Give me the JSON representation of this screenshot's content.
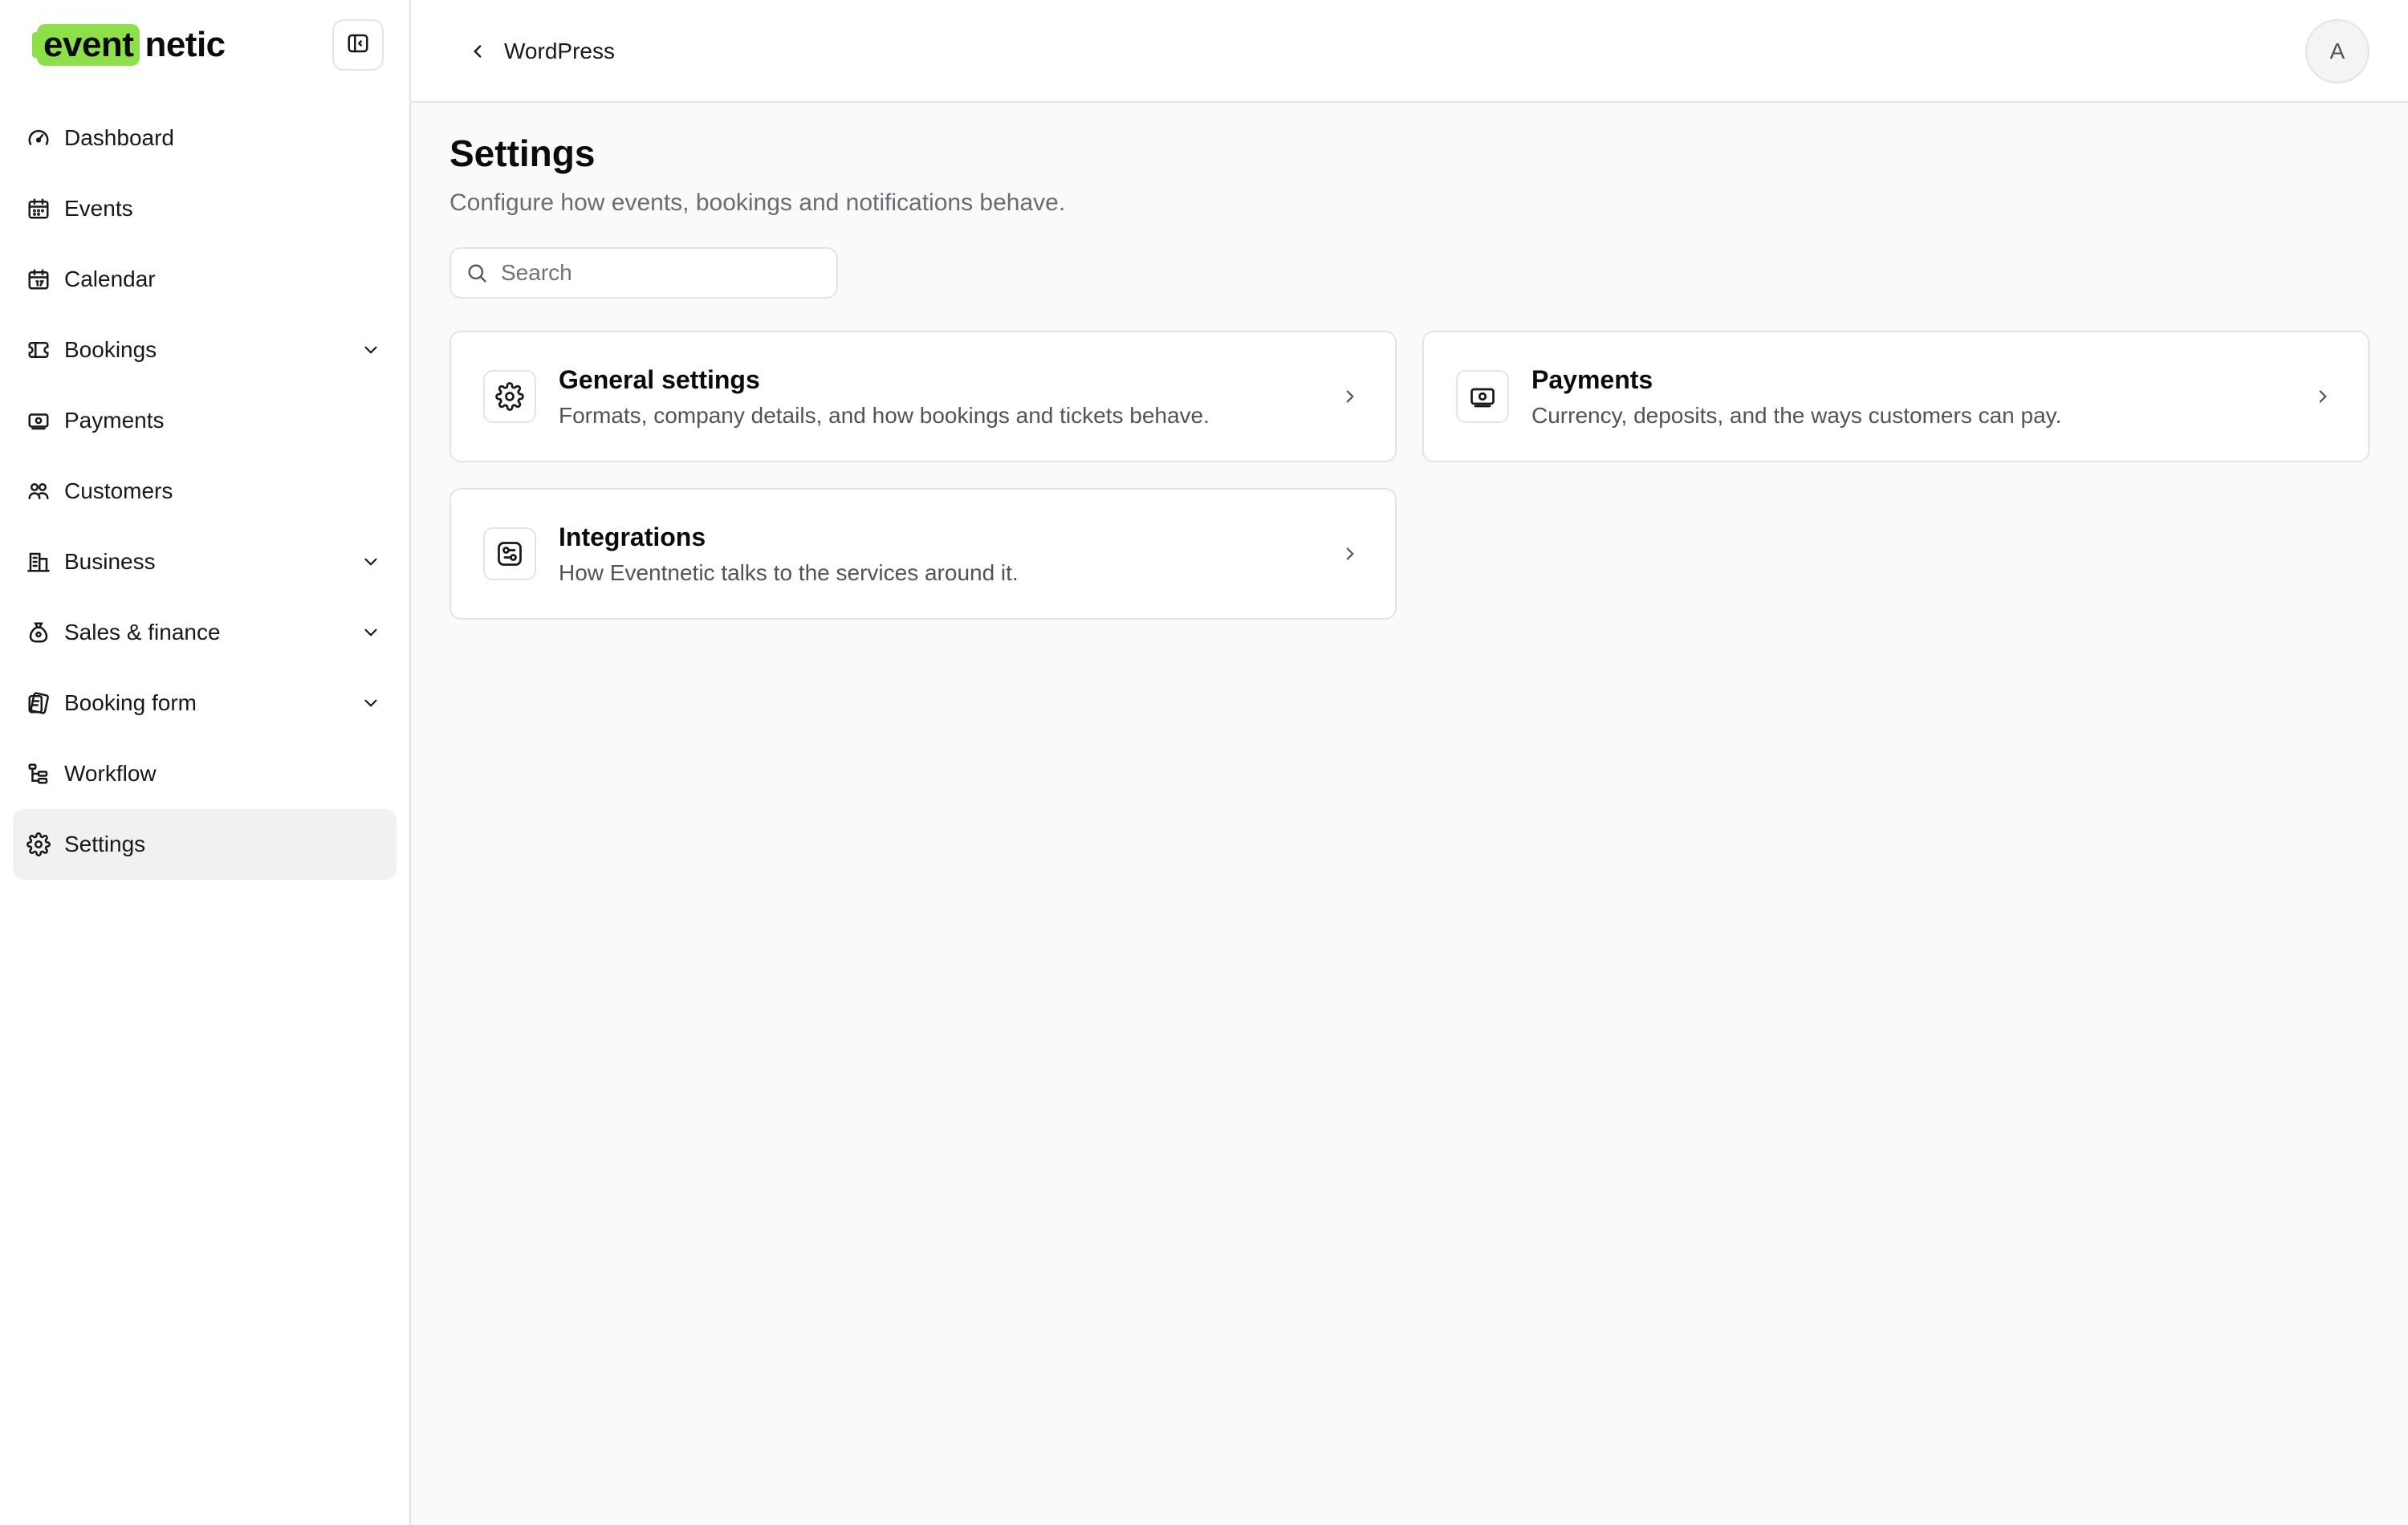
{
  "brand": {
    "part1": "event",
    "part2": "netic",
    "accent": "#8ee04a"
  },
  "sidebar": {
    "items": [
      {
        "label": "Dashboard",
        "icon": "gauge-icon",
        "expandable": false
      },
      {
        "label": "Events",
        "icon": "calendar-grid-icon",
        "expandable": false
      },
      {
        "label": "Calendar",
        "icon": "calendar-icon",
        "expandable": false
      },
      {
        "label": "Bookings",
        "icon": "ticket-icon",
        "expandable": true
      },
      {
        "label": "Payments",
        "icon": "banknote-icon",
        "expandable": false
      },
      {
        "label": "Customers",
        "icon": "users-icon",
        "expandable": false
      },
      {
        "label": "Business",
        "icon": "building-icon",
        "expandable": true
      },
      {
        "label": "Sales & finance",
        "icon": "money-bag-icon",
        "expandable": true
      },
      {
        "label": "Booking form",
        "icon": "form-icon",
        "expandable": true
      },
      {
        "label": "Workflow",
        "icon": "workflow-icon",
        "expandable": false
      },
      {
        "label": "Settings",
        "icon": "gear-icon",
        "expandable": false,
        "active": true
      }
    ]
  },
  "topbar": {
    "back_label": "WordPress",
    "avatar_initial": "A"
  },
  "page": {
    "title": "Settings",
    "subtitle": "Configure how events, bookings and notifications behave.",
    "search_placeholder": "Search"
  },
  "cards": [
    {
      "title": "General settings",
      "description": "Formats, company details, and how bookings and tickets behave.",
      "icon": "gear-icon"
    },
    {
      "title": "Payments",
      "description": "Currency, deposits, and the ways customers can pay.",
      "icon": "banknote-icon"
    },
    {
      "title": "Integrations",
      "description": "How Eventnetic talks to the services around it.",
      "icon": "integrations-icon"
    }
  ]
}
